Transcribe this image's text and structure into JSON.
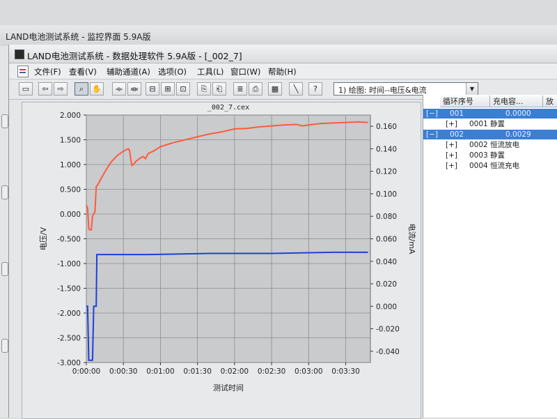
{
  "bg_window": {
    "title": "LAND电池测试系统 - 监控界面 5.9A版"
  },
  "window": {
    "title": "LAND电池测试系统 - 数据处理软件 5.9A版 - [_002_7]"
  },
  "menus": [
    "文件(F)",
    "查看(V)",
    "辅助通道(A)",
    "选项(O)",
    "工具(L)",
    "窗口(W)",
    "帮助(H)"
  ],
  "toolbar": {
    "buttons": [
      {
        "name": "open-icon",
        "glyph": "▭"
      },
      {
        "name": "back-arrow-icon",
        "glyph": "⇦"
      },
      {
        "name": "forward-arrow-icon",
        "glyph": "⇨"
      },
      {
        "name": "zoom-icon",
        "glyph": "⌕"
      },
      {
        "name": "hand-pan-icon",
        "glyph": "✋"
      },
      {
        "name": "h-compress-icon",
        "glyph": "⟛"
      },
      {
        "name": "h-expand-icon",
        "glyph": "⟚"
      },
      {
        "name": "fit-width-icon",
        "glyph": "⊟"
      },
      {
        "name": "fit-height-icon",
        "glyph": "⊞"
      },
      {
        "name": "fit-all-icon",
        "glyph": "⊡"
      },
      {
        "name": "copy-icon",
        "glyph": "⎘"
      },
      {
        "name": "paste-icon",
        "glyph": "⎗"
      },
      {
        "name": "layer-icon",
        "glyph": "≣"
      },
      {
        "name": "print-icon",
        "glyph": "⎙"
      },
      {
        "name": "grid-icon",
        "glyph": "▦"
      },
      {
        "name": "curve-icon",
        "glyph": "╲"
      },
      {
        "name": "help-icon",
        "glyph": "?"
      }
    ],
    "plot_select": "1) 绘图: 时间--电压&电流"
  },
  "chart_data": {
    "type": "line",
    "title": "_002_7.cex",
    "xlabel": "测试时间",
    "ylabel": "电压/V",
    "y2label": "电流/mA",
    "xlim": [
      0,
      230
    ],
    "ylim": [
      -3.0,
      2.0
    ],
    "y2lim": [
      -0.05,
      0.17
    ],
    "x_ticks": [
      0,
      30,
      60,
      90,
      120,
      150,
      180,
      210
    ],
    "x_tick_labels": [
      "0:00:00",
      "0:00:30",
      "0:01:00",
      "0:01:30",
      "0:02:00",
      "0:02:30",
      "0:03:00",
      "0:03:30"
    ],
    "y_ticks": [
      2.0,
      1.5,
      1.0,
      0.5,
      0.0,
      -0.5,
      -1.0,
      -1.5,
      -2.0,
      -2.5,
      -3.0
    ],
    "y_tick_labels": [
      "2.000",
      "1.500",
      "1.000",
      "0.500",
      "0.000",
      "-0.500",
      "-1.000",
      "-1.500",
      "-2.000",
      "-2.500",
      "-3.000"
    ],
    "y2_ticks": [
      0.16,
      0.14,
      0.12,
      0.1,
      0.08,
      0.06,
      0.04,
      0.02,
      0.0,
      -0.02,
      -0.04
    ],
    "y2_tick_labels": [
      "0.160",
      "0.140",
      "0.120",
      "0.100",
      "0.080",
      "0.060",
      "0.040",
      "0.020",
      "0.000",
      "-0.020",
      "-0.040"
    ],
    "grid": true,
    "series": [
      {
        "color": "#ff5a3c",
        "axis": "left",
        "points": [
          [
            0,
            0.18
          ],
          [
            1,
            0.12
          ],
          [
            2,
            -0.3
          ],
          [
            3,
            -0.32
          ],
          [
            4,
            -0.32
          ],
          [
            5,
            -0.05
          ],
          [
            6,
            0.0
          ],
          [
            7,
            0.05
          ],
          [
            8,
            0.55
          ],
          [
            10,
            0.62
          ],
          [
            12,
            0.72
          ],
          [
            15,
            0.85
          ],
          [
            20,
            1.05
          ],
          [
            25,
            1.18
          ],
          [
            30,
            1.27
          ],
          [
            34,
            1.32
          ],
          [
            35,
            1.28
          ],
          [
            36,
            1.1
          ],
          [
            37,
            0.98
          ],
          [
            38,
            1.0
          ],
          [
            40,
            1.06
          ],
          [
            43,
            1.12
          ],
          [
            46,
            1.16
          ],
          [
            48,
            1.12
          ],
          [
            50,
            1.22
          ],
          [
            55,
            1.28
          ],
          [
            60,
            1.36
          ],
          [
            70,
            1.44
          ],
          [
            80,
            1.5
          ],
          [
            90,
            1.56
          ],
          [
            100,
            1.62
          ],
          [
            110,
            1.66
          ],
          [
            120,
            1.72
          ],
          [
            130,
            1.73
          ],
          [
            140,
            1.76
          ],
          [
            150,
            1.78
          ],
          [
            160,
            1.8
          ],
          [
            170,
            1.81
          ],
          [
            175,
            1.78
          ],
          [
            180,
            1.8
          ],
          [
            190,
            1.83
          ],
          [
            200,
            1.84
          ],
          [
            210,
            1.85
          ],
          [
            220,
            1.86
          ],
          [
            228,
            1.85
          ]
        ]
      },
      {
        "color": "#1f3fd8",
        "axis": "right",
        "points": [
          [
            0,
            0.0
          ],
          [
            1,
            0.0
          ],
          [
            2,
            -0.048
          ],
          [
            3,
            -0.048
          ],
          [
            4,
            -0.048
          ],
          [
            5,
            -0.048
          ],
          [
            6,
            0.0
          ],
          [
            7,
            0.0
          ],
          [
            8,
            0.0
          ],
          [
            8.5,
            0.046
          ],
          [
            50,
            0.046
          ],
          [
            100,
            0.047
          ],
          [
            150,
            0.047
          ],
          [
            200,
            0.048
          ],
          [
            228,
            0.048
          ]
        ]
      }
    ]
  },
  "tree": {
    "headers": [
      "循环序号",
      "充电容...",
      "放"
    ],
    "rows": [
      {
        "toggle": "[−]",
        "label": "001",
        "value": "0.0000",
        "indent": 0,
        "highlight": true
      },
      {
        "toggle": "[+]",
        "label": "0001 静置",
        "value": "",
        "indent": 1,
        "highlight": false
      },
      {
        "toggle": "[−]",
        "label": "002",
        "value": "0.0029",
        "indent": 0,
        "highlight": true
      },
      {
        "toggle": "[+]",
        "label": "0002 恒流放电",
        "value": "",
        "indent": 1,
        "highlight": false
      },
      {
        "toggle": "[+]",
        "label": "0003 静置",
        "value": "",
        "indent": 1,
        "highlight": false
      },
      {
        "toggle": "[+]",
        "label": "0004 恒流充电",
        "value": "",
        "indent": 1,
        "highlight": false
      }
    ]
  }
}
